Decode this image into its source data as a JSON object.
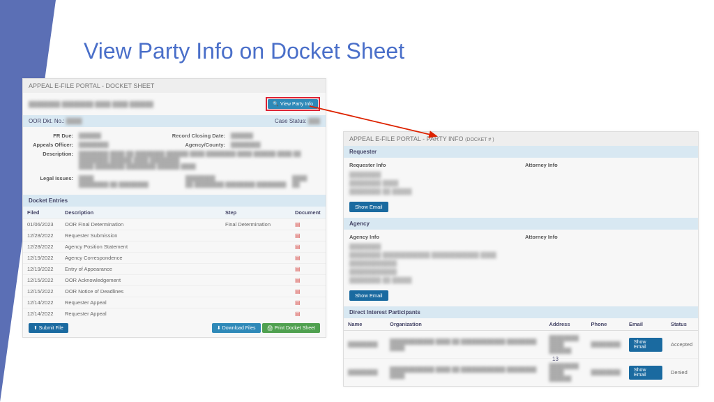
{
  "title": "View Party Info on Docket Sheet",
  "left": {
    "header": "APPEAL E-FILE PORTAL - DOCKET SHEET",
    "viewPartyBtn": "🔍 View Party Info",
    "docketBar": {
      "left": "OOR Dkt. No.:",
      "right": "Case Status:"
    },
    "fields": {
      "frDue": "FR Due:",
      "recordClosing": "Record Closing Date:",
      "appealsOfficer": "Appeals Officer:",
      "agencyCounty": "Agency/County:",
      "description": "Description:",
      "legalIssues": "Legal Issues:"
    },
    "entriesHead": "Docket Entries",
    "columns": {
      "filed": "Filed",
      "desc": "Description",
      "step": "Step",
      "doc": "Document"
    },
    "rows": [
      {
        "date": "01/06/2023",
        "desc": "OOR Final Determination",
        "step": "Final Determination"
      },
      {
        "date": "12/28/2022",
        "desc": "Requester Submission",
        "step": ""
      },
      {
        "date": "12/28/2022",
        "desc": "Agency Position Statement",
        "step": ""
      },
      {
        "date": "12/19/2022",
        "desc": "Agency Correspondence",
        "step": ""
      },
      {
        "date": "12/19/2022",
        "desc": "Entry of Appearance",
        "step": ""
      },
      {
        "date": "12/15/2022",
        "desc": "OOR Acknowledgement",
        "step": ""
      },
      {
        "date": "12/15/2022",
        "desc": "OOR Notice of Deadlines",
        "step": ""
      },
      {
        "date": "12/14/2022",
        "desc": "Requester Appeal",
        "step": ""
      },
      {
        "date": "12/14/2022",
        "desc": "Requester Appeal",
        "step": ""
      }
    ],
    "footer": {
      "submit": "⬆ Submit File",
      "download": "⬇ Download Files",
      "print": "🖨 Print Docket Sheet"
    }
  },
  "right": {
    "header": "APPEAL E-FILE PORTAL - PARTY INFO",
    "headerSuffix": "(DOCKET #            )",
    "requesterHead": "Requester",
    "requesterInfo": "Requester Info",
    "attorneyInfo": "Attorney Info",
    "showEmail": "Show Email",
    "agencyHead": "Agency",
    "agencyInfo": "Agency Info",
    "dipHead": "Direct Interest Participants",
    "dipCols": {
      "name": "Name",
      "org": "Organization",
      "addr": "Address",
      "phone": "Phone",
      "email": "Email",
      "status": "Status"
    },
    "dipRows": [
      {
        "status": "Accepted"
      },
      {
        "status": "Denied"
      }
    ]
  },
  "pageNum": "13"
}
